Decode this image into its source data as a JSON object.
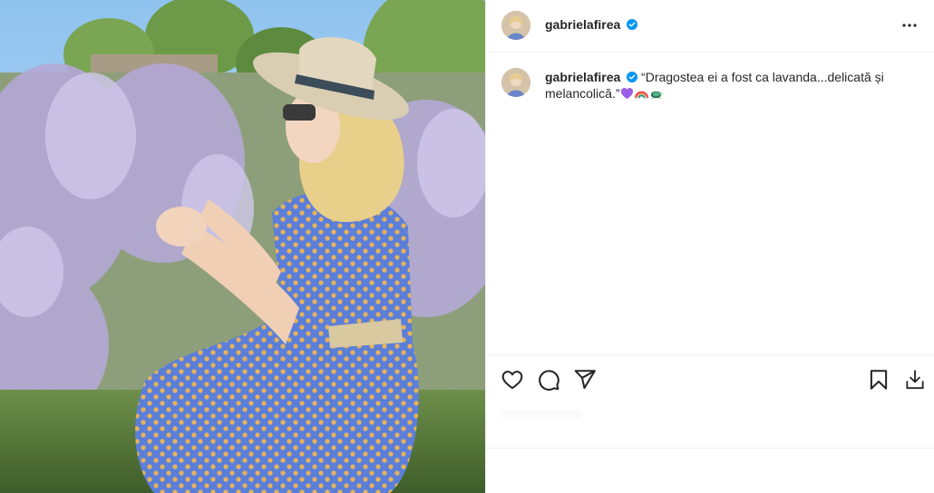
{
  "post": {
    "username": "gabrielafirea",
    "verified": true,
    "caption": {
      "username": "gabrielafirea",
      "text": "“Dragostea ei a fost ca lavanda...delicată și melancolică.”",
      "emojis": [
        "purple-heart-emoji",
        "rainbow-emoji",
        "turtle-emoji"
      ]
    }
  },
  "icons": {
    "more": "more-horizontal-icon",
    "like": "heart-icon",
    "comment": "comment-icon",
    "share": "send-icon",
    "save": "bookmark-icon",
    "download": "download-icon"
  },
  "colors": {
    "verified_blue": "#0095f6",
    "text": "#262626",
    "divider": "#efefef"
  }
}
